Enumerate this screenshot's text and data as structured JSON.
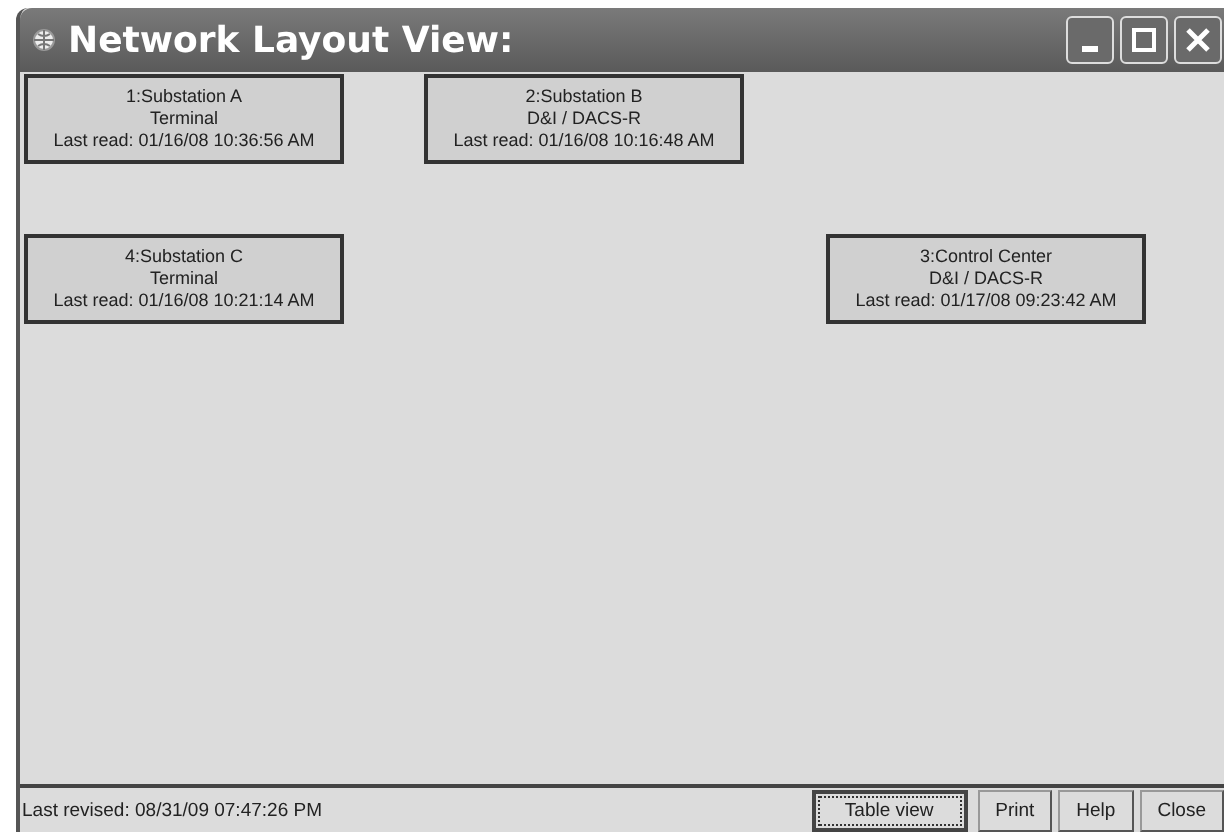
{
  "window": {
    "title": "Network Layout View:"
  },
  "nodes": [
    {
      "name": "1:Substation A",
      "type": "Terminal",
      "last_read": "Last read: 01/16/08 10:36:56 AM"
    },
    {
      "name": "2:Substation B",
      "type": "D&I / DACS-R",
      "last_read": "Last read: 01/16/08 10:16:48 AM"
    },
    {
      "name": "4:Substation C",
      "type": "Terminal",
      "last_read": "Last read: 01/16/08 10:21:14 AM"
    },
    {
      "name": "3:Control Center",
      "type": "D&I / DACS-R",
      "last_read": "Last read: 01/17/08 09:23:42 AM"
    }
  ],
  "status_bar": {
    "text": "Last revised: 08/31/09 07:47:26 PM",
    "buttons": [
      {
        "label": "Table view",
        "focused": true
      },
      {
        "label": "Print",
        "focused": false
      },
      {
        "label": "Help",
        "focused": false
      },
      {
        "label": "Close",
        "focused": false
      }
    ]
  }
}
